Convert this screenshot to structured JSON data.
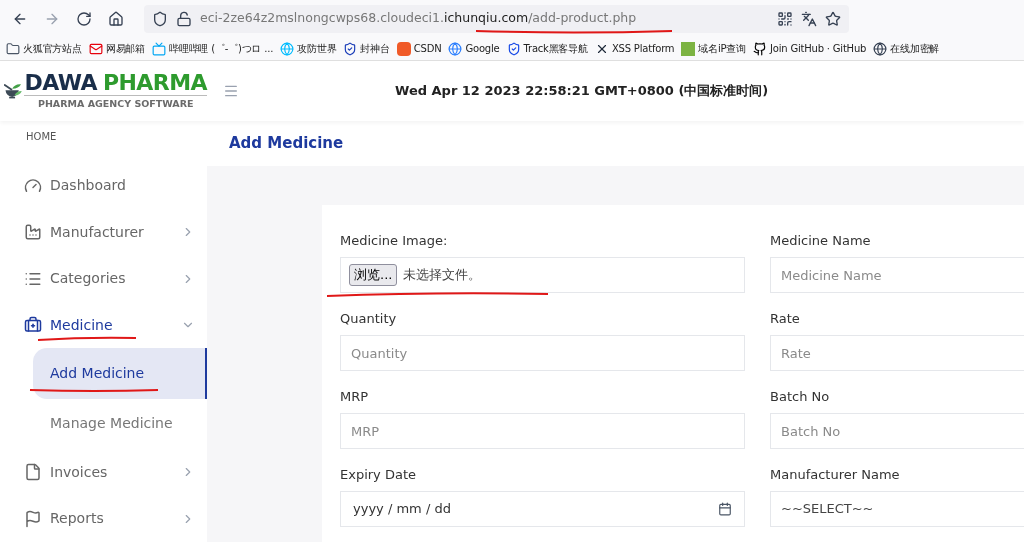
{
  "browser": {
    "url_host": "eci-2ze64z2mslnongcwps68.cloudeci1.",
    "url_domain": "ichunqiu.com",
    "url_path": "/add-product.php"
  },
  "bookmarks": [
    {
      "label": "火狐官方站点"
    },
    {
      "label": "网易邮箱"
    },
    {
      "label": "哔哩哔哩 (゜-゜)つロ ..."
    },
    {
      "label": "攻防世界"
    },
    {
      "label": "封神台"
    },
    {
      "label": "CSDN"
    },
    {
      "label": "Google"
    },
    {
      "label": "Track黑客导航"
    },
    {
      "label": "XSS Platform"
    },
    {
      "label": "域名iP查询"
    },
    {
      "label": "Join GitHub · GitHub"
    },
    {
      "label": "在线加密解"
    }
  ],
  "logo": {
    "word_1": "DAWA",
    "word_2": "PHARMA",
    "tagline": "PHARMA AGENCY SOFTWARE"
  },
  "header": {
    "datetime": "Wed Apr 12 2023 22:58:21 GMT+0800 (中国标准时间)"
  },
  "sidebar": {
    "heading": "HOME",
    "items": [
      {
        "label": "Dashboard",
        "selected": false
      },
      {
        "label": "Manufacturer",
        "selected": false,
        "expanded": false
      },
      {
        "label": "Categories",
        "selected": false,
        "expanded": false
      },
      {
        "label": "Medicine",
        "selected": true,
        "expanded": true,
        "children": [
          {
            "label": "Add Medicine",
            "selected": true
          },
          {
            "label": "Manage Medicine",
            "selected": false
          }
        ]
      },
      {
        "label": "Invoices",
        "selected": false,
        "expanded": false
      },
      {
        "label": "Reports",
        "selected": false,
        "expanded": false
      }
    ]
  },
  "page": {
    "title": "Add Medicine"
  },
  "form": {
    "fields": [
      {
        "kind": "file",
        "label": "Medicine Image:",
        "button": "浏览...",
        "value": "未选择文件。"
      },
      {
        "kind": "text",
        "label": "Medicine Name",
        "placeholder": "Medicine Name"
      },
      {
        "kind": "text",
        "label": "Quantity",
        "placeholder": "Quantity"
      },
      {
        "kind": "text",
        "label": "Rate",
        "placeholder": "Rate"
      },
      {
        "kind": "text",
        "label": "MRP",
        "placeholder": "MRP"
      },
      {
        "kind": "text",
        "label": "Batch No",
        "placeholder": "Batch No"
      },
      {
        "kind": "date",
        "label": "Expiry Date",
        "placeholder": "yyyy / mm / dd"
      },
      {
        "kind": "select",
        "label": "Manufacturer Name",
        "value": "~~SELECT~~"
      }
    ]
  }
}
